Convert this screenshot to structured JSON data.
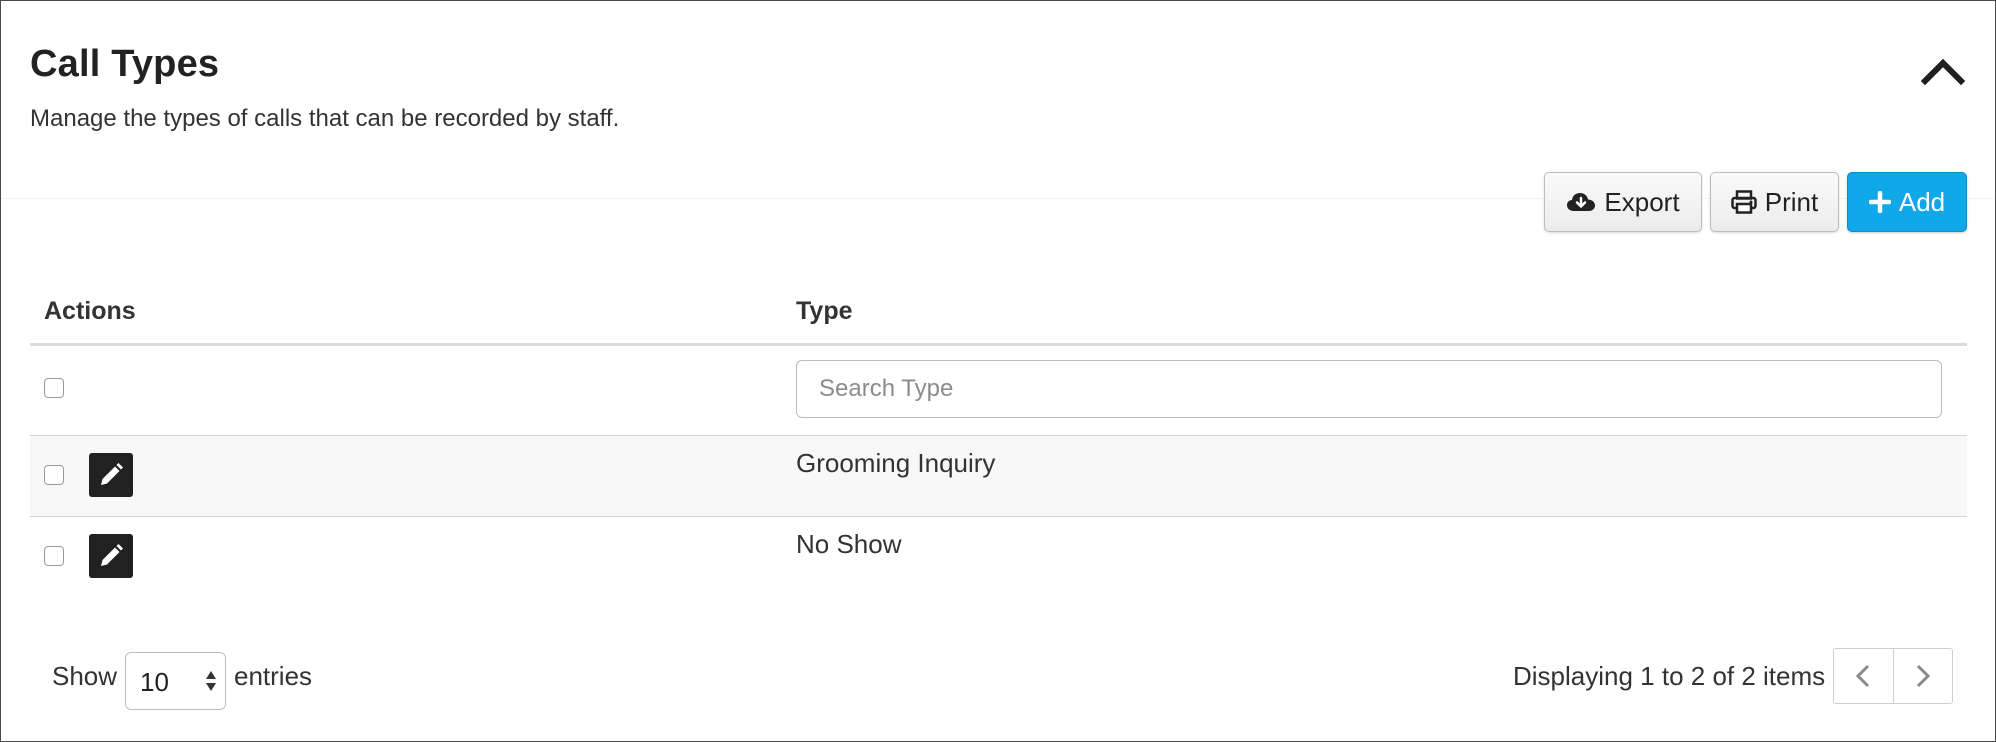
{
  "header": {
    "title": "Call Types",
    "subtitle": "Manage the types of calls that can be recorded by staff."
  },
  "toolbar": {
    "export_label": "Export",
    "print_label": "Print",
    "add_label": "Add"
  },
  "table": {
    "columns": [
      "Actions",
      "Type"
    ],
    "search_placeholder": "Search Type",
    "rows": [
      {
        "type": "Grooming Inquiry"
      },
      {
        "type": "No Show"
      }
    ]
  },
  "footer": {
    "show_label": "Show",
    "page_size": "10",
    "entries_label": "entries",
    "displaying": "Displaying 1 to 2 of 2 items"
  },
  "colors": {
    "primary": "#10a8e8",
    "edit_button": "#212121",
    "border": "#4a4a4a"
  },
  "icons": [
    "chevron-up-icon",
    "cloud-download-icon",
    "print-icon",
    "plus-icon",
    "pencil-icon",
    "chevron-left-icon",
    "chevron-right-icon",
    "sort-arrows-icon"
  ]
}
